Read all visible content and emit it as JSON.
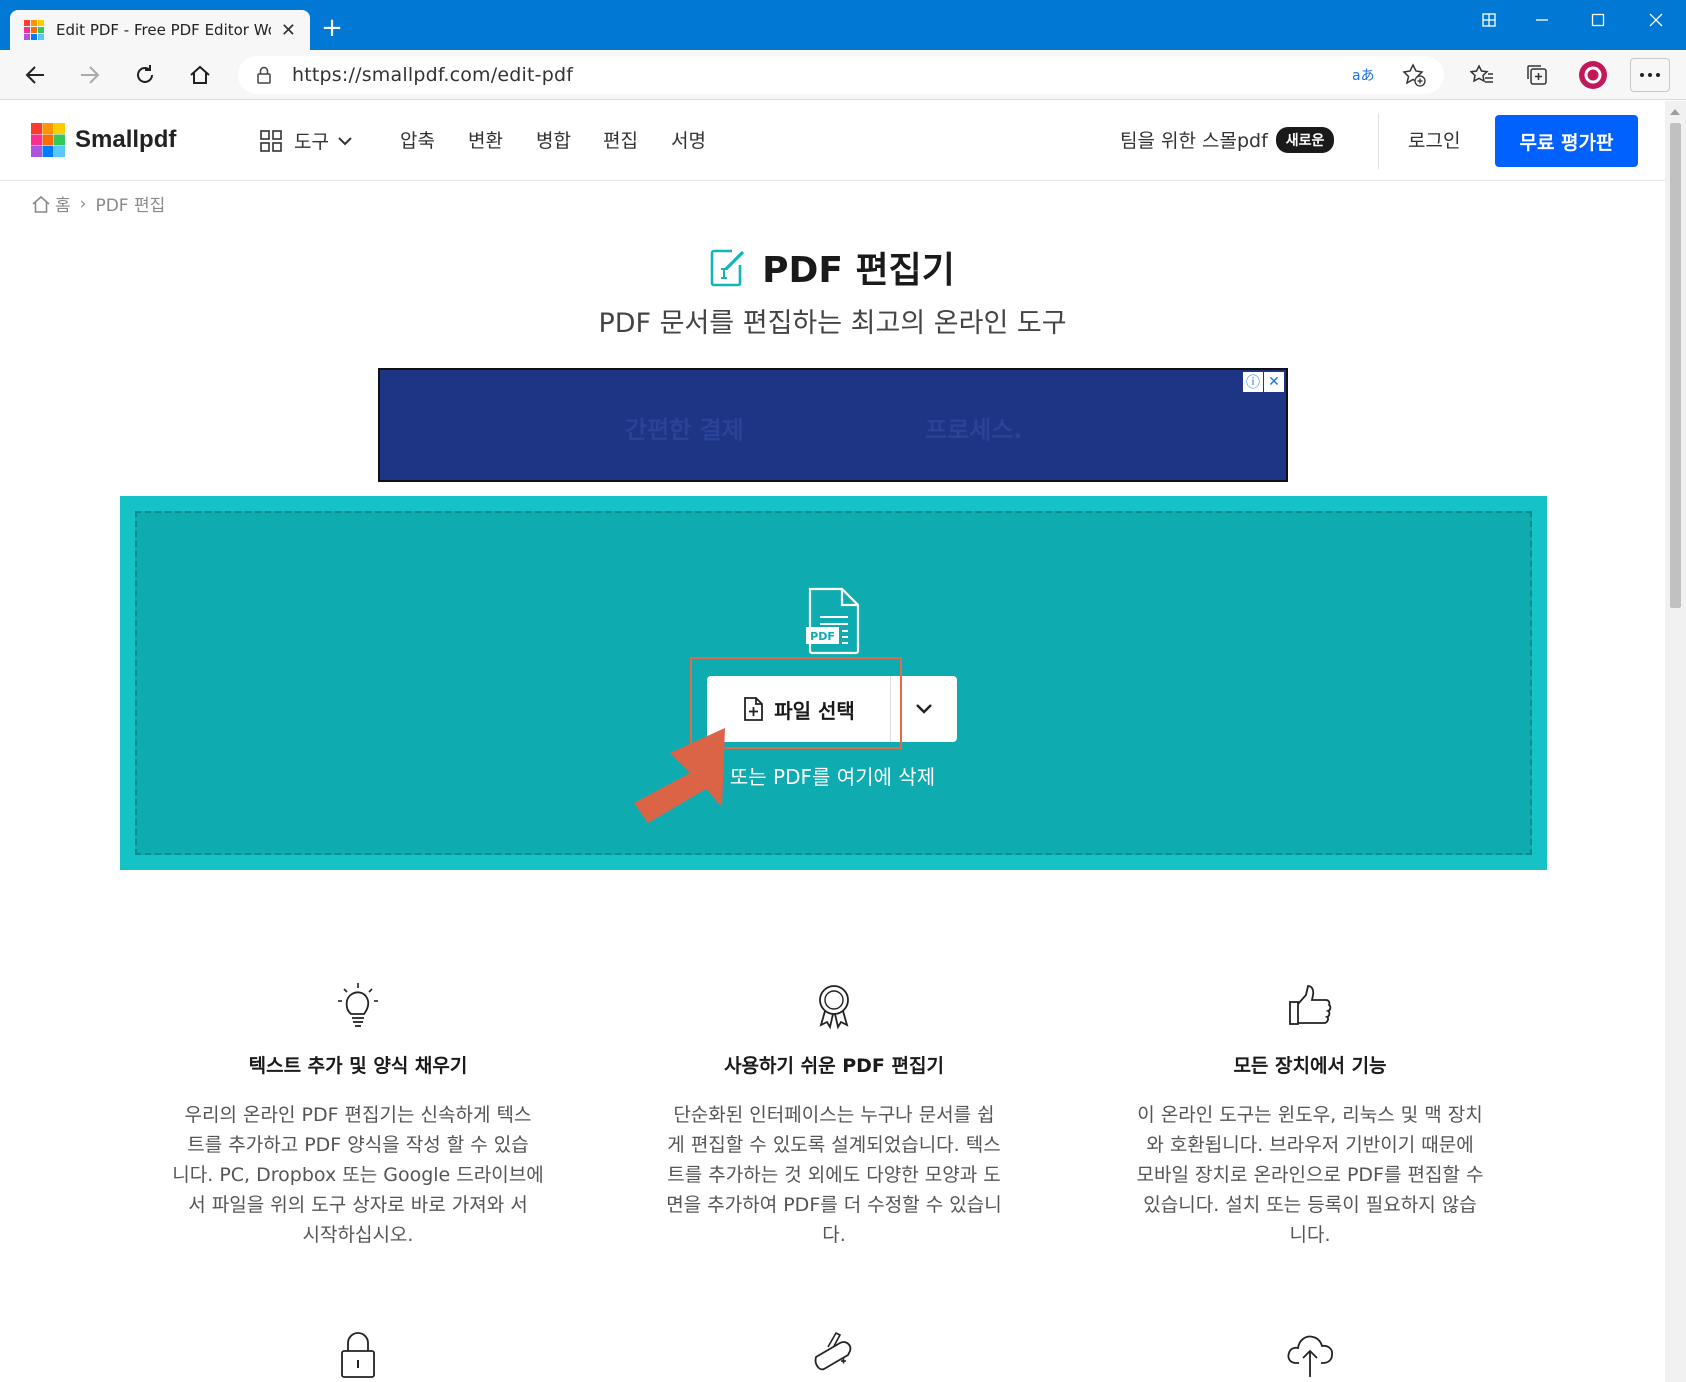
{
  "browser": {
    "tab_title": "Edit PDF - Free PDF Editor Worki",
    "new_tab": "+",
    "url": "https://smallpdf.com/edit-pdf"
  },
  "nav": {
    "logo": "Smallpdf",
    "tools": "도구",
    "links": [
      "압축",
      "변환",
      "병합",
      "편집",
      "서명"
    ],
    "team": "팀을 위한 스몰pdf",
    "team_badge": "새로운",
    "login": "로그인",
    "trial": "무료 평가판"
  },
  "breadcrumb": {
    "home": "홈",
    "separator": "›",
    "current": "PDF 편집"
  },
  "hero": {
    "title": "PDF 편집기",
    "subtitle": "PDF 문서를 편집하는 최고의 온라인 도구"
  },
  "ad": {
    "text_left": "간편한 결제",
    "text_right": "프로세스."
  },
  "dropzone": {
    "file_badge": "PDF",
    "choose_label": "파일 선택",
    "hint": "또는 PDF를 여기에 삭제"
  },
  "features": [
    {
      "icon": "lightbulb-icon",
      "title": "텍스트 추가 및 양식 채우기",
      "lines": [
        "우리의 온라인 PDF 편집기는 신속하게 텍스",
        "트를 추가하고 PDF 양식을 작성 할 수 있습",
        "니다. PC, Dropbox 또는 Google 드라이브에",
        "서 파일을 위의 도구 상자로 바로 가져와 서",
        "시작하십시오."
      ]
    },
    {
      "icon": "award-icon",
      "title": "사용하기 쉬운 PDF 편집기",
      "lines": [
        "단순화된 인터페이스는 누구나 문서를 쉽",
        "게 편집할 수 있도록 설계되었습니다. 텍스",
        "트를 추가하는 것 외에도 다양한 모양과 도",
        "면을 추가하여 PDF를 더 수정할 수 있습니",
        "다."
      ]
    },
    {
      "icon": "thumbs-up-icon",
      "title": "모든 장치에서 기능",
      "lines": [
        "이 온라인 도구는 윈도우, 리눅스 및 맥 장치",
        "와 호환됩니다. 브라우저 기반이기 때문에",
        "모바일 장치로 온라인으로 PDF를 편집할 수",
        "있습니다. 설치 또는 등록이 필요하지 않습",
        "니다."
      ]
    }
  ],
  "colors": {
    "brand_blue": "#0061fe",
    "titlebar": "#0078d4",
    "dropzone": "#15c2c6",
    "dropzone_inner": "#0eacb0",
    "annotation": "#e06a4a",
    "ad_bg": "#1e3485"
  }
}
